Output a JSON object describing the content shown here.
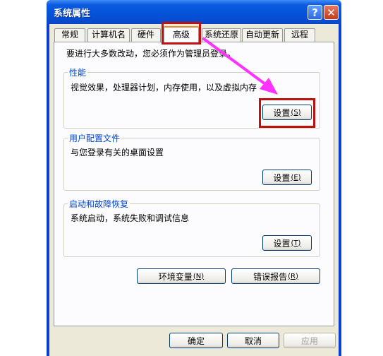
{
  "window": {
    "title": "系统属性",
    "help_glyph": "?",
    "close_glyph": "✕"
  },
  "tabs": [
    {
      "label": "常规"
    },
    {
      "label": "计算机名"
    },
    {
      "label": "硬件"
    },
    {
      "label": "高级"
    },
    {
      "label": "系统还原"
    },
    {
      "label": "自动更新"
    },
    {
      "label": "远程"
    }
  ],
  "active_tab": "高级",
  "notice": "要进行大多数改动，您必须作为管理员登录。",
  "performance": {
    "title": "性能",
    "desc": "视觉效果，处理器计划，内存使用，以及虚拟内存",
    "button": "设置",
    "mnemonic": "(S)"
  },
  "profiles": {
    "title": "用户配置文件",
    "desc": "与您登录有关的桌面设置",
    "button": "设置",
    "mnemonic": "(E)"
  },
  "startup": {
    "title": "启动和故障恢复",
    "desc": "系统启动，系统失败和调试信息",
    "button": "设置",
    "mnemonic": "(T)"
  },
  "env_button": {
    "label": "环境变量",
    "mnemonic": "(N)"
  },
  "error_button": {
    "label": "错误报告",
    "mnemonic": "(R)"
  },
  "footer": {
    "ok": "确定",
    "cancel": "取消",
    "apply": "应用"
  },
  "colors": {
    "highlight": "#c01010",
    "arrow": "#ff33ff",
    "titlebar": "#0452d8"
  }
}
